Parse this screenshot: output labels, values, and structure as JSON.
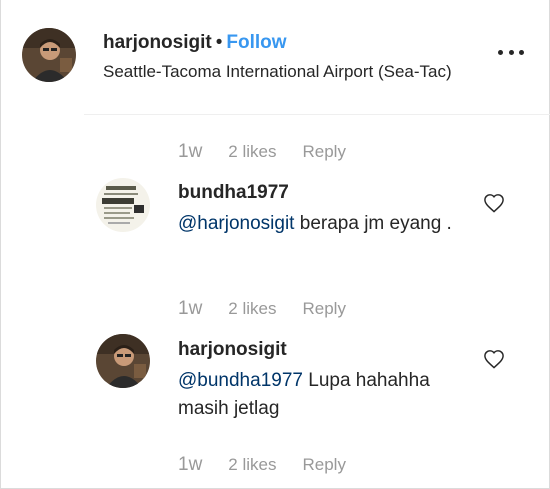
{
  "post_header": {
    "username": "harjonosigit",
    "separator": "•",
    "follow_label": "Follow",
    "location": "Seattle-Tacoma International Airport (Sea-Tac)",
    "more_icon": "more-options-icon"
  },
  "top_meta": {
    "time": "1w",
    "likes": "2 likes",
    "reply": "Reply"
  },
  "comments": [
    {
      "username": "bundha1977",
      "mention": "@harjonosigit",
      "text": " berapa jm eyang .",
      "time": "1w",
      "likes": "2 likes",
      "reply": "Reply",
      "like_icon": "heart-outline-icon"
    },
    {
      "username": "harjonosigit",
      "mention": "@bundha1977",
      "text": " Lupa hahahha masih jetlag",
      "time": "1w",
      "likes": "2 likes",
      "reply": "Reply",
      "like_icon": "heart-outline-icon"
    }
  ],
  "colors": {
    "link_blue": "#3897f0",
    "mention_dark_blue": "#003569",
    "meta_gray": "#999999",
    "text": "#262626"
  }
}
